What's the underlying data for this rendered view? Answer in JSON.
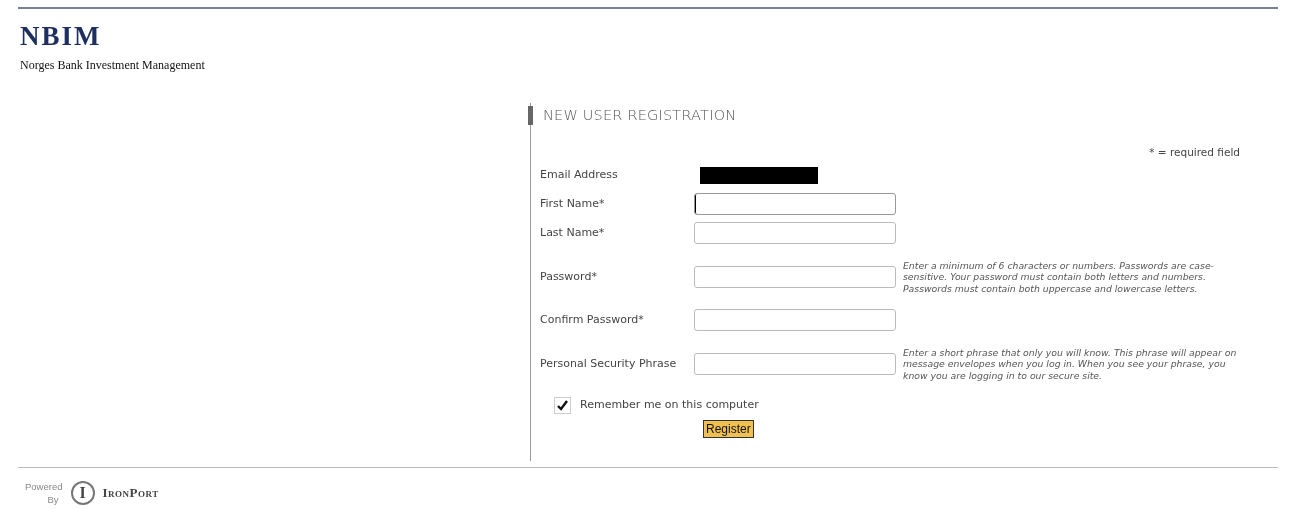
{
  "header": {
    "logo": "NBIM",
    "subtitle": "Norges Bank Investment Management"
  },
  "form": {
    "title": "NEW USER REGISTRATION",
    "required_note": "* = required field",
    "fields": [
      {
        "kind": "redacted",
        "label": "Email Address"
      },
      {
        "kind": "input",
        "label": "First Name*",
        "focused": true
      },
      {
        "kind": "input",
        "label": "Last Name*",
        "focused": false
      },
      {
        "kind": "input",
        "label": "Password*",
        "focused": false,
        "hint": "Enter a minimum of 6 characters or numbers. Passwords are case-sensitive. Your password must contain both letters and numbers. Passwords must contain both uppercase and lowercase letters."
      },
      {
        "kind": "input",
        "label": "Confirm Password*",
        "focused": false
      },
      {
        "kind": "input",
        "label": "Personal Security Phrase",
        "focused": false,
        "hint": "Enter a short phrase that only you will know. This phrase will appear on message envelopes when you log in. When you see your phrase, you know you are logging in to our secure site."
      }
    ],
    "remember": {
      "label": "Remember me on this computer",
      "checked": true
    },
    "submit": "Register"
  },
  "footer": {
    "powered": "Powered",
    "by": "By",
    "logo_letter": "I",
    "brand": "IronPort"
  }
}
